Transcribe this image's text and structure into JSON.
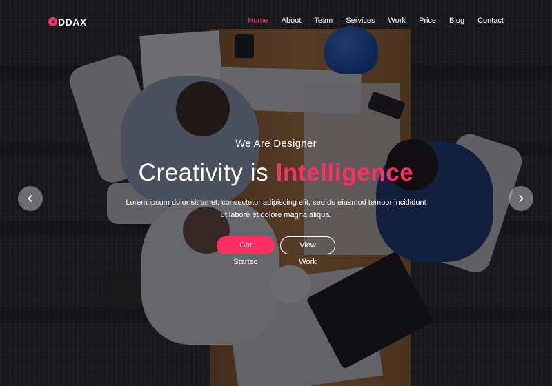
{
  "brand": {
    "logo_text": "DDAX",
    "accent": "#ff2e63"
  },
  "nav": {
    "items": [
      {
        "label": "Home",
        "active": true
      },
      {
        "label": "About"
      },
      {
        "label": "Team"
      },
      {
        "label": "Services"
      },
      {
        "label": "Work"
      },
      {
        "label": "Price"
      },
      {
        "label": "Blog"
      },
      {
        "label": "Contact"
      }
    ]
  },
  "hero": {
    "subtitle": "We Are Designer",
    "title_plain": "Creativity is",
    "title_highlight": "Intelligence",
    "description": "Lorem ipsum dolor sit amet, consectetur adipiscing elit, sed do eiusmod tempor incididunt ut labore et dolore magna aliqua.",
    "primary_button": "Get Started",
    "secondary_button": "View Work"
  },
  "slider": {
    "prev_icon": "chevron-left-icon",
    "next_icon": "chevron-right-icon"
  }
}
